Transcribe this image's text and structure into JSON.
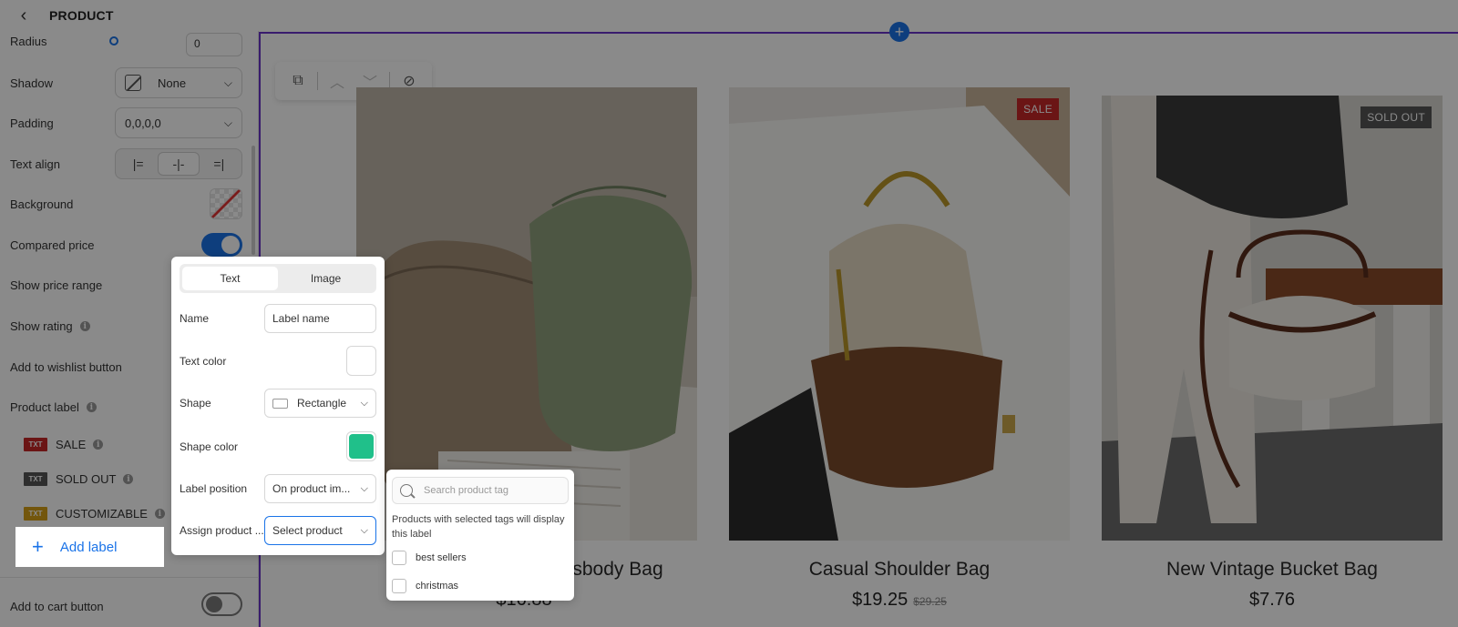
{
  "sidebar": {
    "title": "PRODUCT",
    "radius": {
      "label": "Radius",
      "value": "0"
    },
    "shadow": {
      "label": "Shadow",
      "value": "None"
    },
    "padding": {
      "label": "Padding",
      "value": "0,0,0,0"
    },
    "text_align": {
      "label": "Text align"
    },
    "background": {
      "label": "Background"
    },
    "compared_price": {
      "label": "Compared price",
      "on": true
    },
    "show_price_range": {
      "label": "Show price range"
    },
    "show_rating": {
      "label": "Show rating"
    },
    "add_to_wishlist": {
      "label": "Add to wishlist button"
    },
    "product_label": {
      "label": "Product label"
    },
    "labels": [
      {
        "badge": "TXT",
        "name": "SALE",
        "color": "#c62828"
      },
      {
        "badge": "TXT",
        "name": "SOLD OUT",
        "color": "#555555"
      },
      {
        "badge": "TXT",
        "name": "CUSTOMIZABLE",
        "color": "#d4a017"
      }
    ],
    "add_label": "Add label",
    "add_to_cart": {
      "label": "Add to cart button",
      "on": false
    }
  },
  "popup": {
    "tabs": [
      "Text",
      "Image"
    ],
    "active_tab": "Text",
    "name_label": "Name",
    "name_placeholder": "Label name",
    "text_color_label": "Text color",
    "text_color": "#ffffff",
    "shape_label": "Shape",
    "shape_value": "Rectangle",
    "shape_color_label": "Shape color",
    "shape_color": "#20c08a",
    "position_label": "Label position",
    "position_value": "On product im...",
    "assign_label": "Assign product ...",
    "assign_value": "Select product"
  },
  "tag_dropdown": {
    "search_placeholder": "Search product tag",
    "hint": "Products with selected tags will display this label",
    "options": [
      "best sellers",
      "christmas"
    ]
  },
  "products": [
    {
      "title": "F... ossbody Bag",
      "title_left": "F",
      "title_right": "ossbody Bag",
      "price": "$16.88",
      "badge": ""
    },
    {
      "title": "Casual Shoulder Bag",
      "price": "$19.25",
      "compare_price": "$29.25",
      "badge": "SALE",
      "badge_color": "#c62828"
    },
    {
      "title": "New Vintage Bucket Bag",
      "price": "$7.76",
      "badge": "SOLD OUT",
      "badge_color": "#555555"
    }
  ],
  "colors": {
    "accent": "#1a73e8",
    "section_outline": "#6a35c9"
  }
}
